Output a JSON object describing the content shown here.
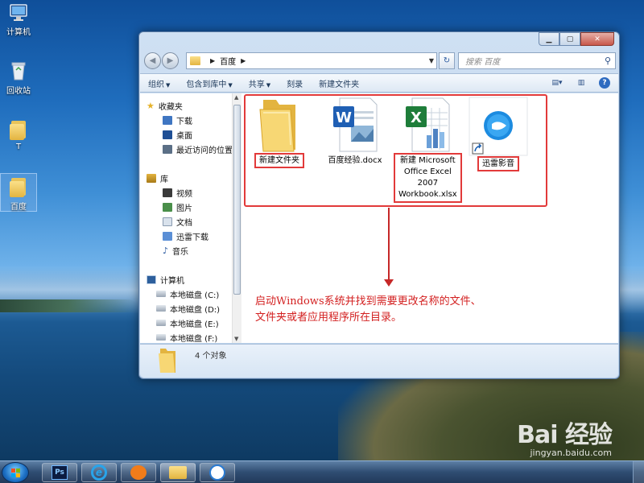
{
  "desktop": {
    "icons": [
      {
        "label": "计算机",
        "icon": "computer-icon"
      },
      {
        "label": "回收站",
        "icon": "recycle-bin-icon"
      },
      {
        "label": "T",
        "icon": "folder-icon"
      },
      {
        "label": "百度",
        "icon": "folder-icon",
        "selected": true
      }
    ]
  },
  "window": {
    "address": {
      "path": [
        "百度"
      ]
    },
    "search": {
      "placeholder": "搜索 百度"
    },
    "toolbar": {
      "items": [
        "组织",
        "包含到库中",
        "共享",
        "刻录",
        "新建文件夹"
      ]
    },
    "nav": {
      "favorites_header": "收藏夹",
      "favorites": [
        "下载",
        "桌面",
        "最近访问的位置"
      ],
      "libraries_header": "库",
      "libraries": [
        "视频",
        "图片",
        "文档",
        "迅雷下载",
        "音乐"
      ],
      "computer_header": "计算机",
      "drives": [
        "本地磁盘 (C:)",
        "本地磁盘 (D:)",
        "本地磁盘 (E:)",
        "本地磁盘 (F:)"
      ]
    },
    "files": [
      {
        "name": "新建文件夹",
        "type": "folder",
        "highlighted": true
      },
      {
        "name": "百度经验.docx",
        "type": "word",
        "highlighted": false
      },
      {
        "name_lines": [
          "新建 Microsoft",
          "Office Excel",
          "2007",
          "Workbook.xlsx"
        ],
        "type": "excel",
        "highlighted": true
      },
      {
        "name": "迅雷影音",
        "type": "shortcut",
        "highlighted": true
      }
    ],
    "details": {
      "count_text": "4 个对象"
    }
  },
  "annotation": {
    "line1": "启动Windows系统并找到需要更改名称的文件、",
    "line2": "文件夹或者应用程序所在目录。"
  },
  "taskbar": {
    "apps": [
      "photoshop-icon",
      "internet-explorer-icon",
      "uc-browser-icon",
      "explorer-icon",
      "xunlei-icon"
    ]
  },
  "watermark": {
    "logo": "Bai 经验",
    "url": "jingyan.baidu.com"
  },
  "colors": {
    "annotation_red": "#e23a3a",
    "selection_blue": "#2e6bc0"
  }
}
